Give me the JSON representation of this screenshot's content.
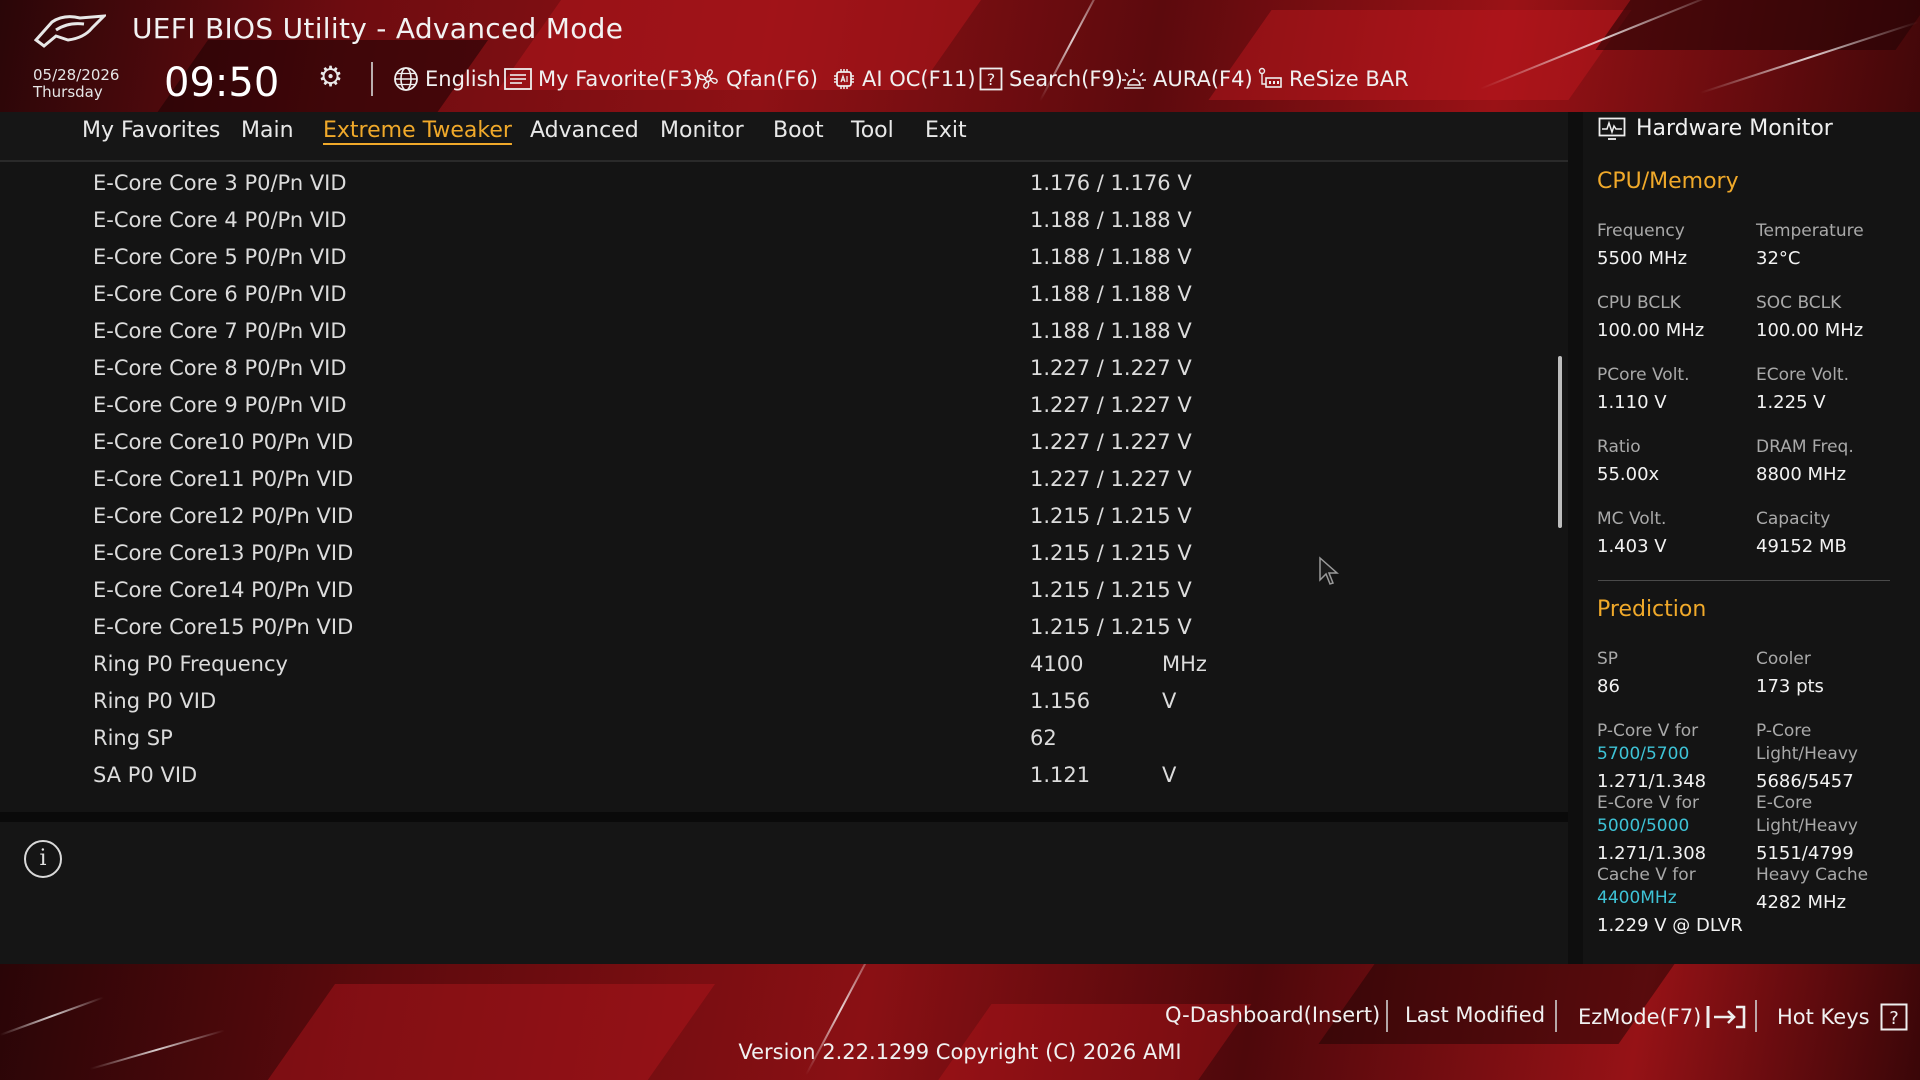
{
  "header": {
    "title": "UEFI BIOS Utility - Advanced Mode",
    "date": "05/28/2026",
    "day": "Thursday",
    "time": "09:50",
    "tools": [
      {
        "label": "English",
        "icon": "globe-icon"
      },
      {
        "label": "My Favorite(F3)",
        "icon": "favorite-list-icon"
      },
      {
        "label": "Qfan(F6)",
        "icon": "fan-icon"
      },
      {
        "label": "AI OC(F11)",
        "icon": "ai-chip-icon"
      },
      {
        "label": "Search(F9)",
        "icon": "search-help-icon"
      },
      {
        "label": "AURA(F4)",
        "icon": "aura-light-icon"
      },
      {
        "label": "ReSize BAR",
        "icon": "resize-bar-icon"
      }
    ]
  },
  "nav": {
    "items": [
      "My Favorites",
      "Main",
      "Extreme Tweaker",
      "Advanced",
      "Monitor",
      "Boot",
      "Tool",
      "Exit"
    ],
    "active": "Extreme Tweaker"
  },
  "settings": [
    {
      "label": "E-Core Core 3 P0/Pn VID",
      "value": "1.176 / 1.176 V",
      "unit": ""
    },
    {
      "label": "E-Core Core 4 P0/Pn VID",
      "value": "1.188 / 1.188 V",
      "unit": ""
    },
    {
      "label": "E-Core Core 5 P0/Pn VID",
      "value": "1.188 / 1.188 V",
      "unit": ""
    },
    {
      "label": "E-Core Core 6 P0/Pn VID",
      "value": "1.188 / 1.188 V",
      "unit": ""
    },
    {
      "label": "E-Core Core 7 P0/Pn VID",
      "value": "1.188 / 1.188 V",
      "unit": ""
    },
    {
      "label": "E-Core Core 8 P0/Pn VID",
      "value": "1.227 / 1.227 V",
      "unit": ""
    },
    {
      "label": "E-Core Core 9 P0/Pn VID",
      "value": "1.227 / 1.227 V",
      "unit": ""
    },
    {
      "label": "E-Core Core10 P0/Pn VID",
      "value": "1.227 / 1.227 V",
      "unit": ""
    },
    {
      "label": "E-Core Core11 P0/Pn VID",
      "value": "1.227 / 1.227 V",
      "unit": ""
    },
    {
      "label": "E-Core Core12 P0/Pn VID",
      "value": "1.215 / 1.215 V",
      "unit": ""
    },
    {
      "label": "E-Core Core13 P0/Pn VID",
      "value": "1.215 / 1.215 V",
      "unit": ""
    },
    {
      "label": "E-Core Core14 P0/Pn VID",
      "value": "1.215 / 1.215 V",
      "unit": ""
    },
    {
      "label": "E-Core Core15 P0/Pn VID",
      "value": "1.215 / 1.215 V",
      "unit": ""
    },
    {
      "label": "Ring P0 Frequency",
      "value": " 4100",
      "unit": "MHz"
    },
    {
      "label": "Ring P0 VID",
      "value": "1.156",
      "unit": "V"
    },
    {
      "label": "Ring SP",
      "value": " 62",
      "unit": ""
    },
    {
      "label": "SA P0 VID",
      "value": "1.121",
      "unit": "V"
    }
  ],
  "hardware_monitor": {
    "title": "Hardware Monitor",
    "cpu_memory": {
      "section": "CPU/Memory",
      "frequency_label": "Frequency",
      "frequency": "5500 MHz",
      "temperature_label": "Temperature",
      "temperature": "32°C",
      "cpu_bclk_label": "CPU BCLK",
      "cpu_bclk": "100.00 MHz",
      "soc_bclk_label": "SOC BCLK",
      "soc_bclk": "100.00 MHz",
      "pcore_volt_label": "PCore Volt.",
      "pcore_volt": "1.110 V",
      "ecore_volt_label": "ECore Volt.",
      "ecore_volt": "1.225 V",
      "ratio_label": "Ratio",
      "ratio": "55.00x",
      "dram_freq_label": "DRAM Freq.",
      "dram_freq": "8800 MHz",
      "mc_volt_label": "MC Volt.",
      "mc_volt": "1.403 V",
      "capacity_label": "Capacity",
      "capacity": "49152 MB"
    },
    "prediction": {
      "section": "Prediction",
      "sp_label": "SP",
      "sp": "86",
      "cooler_label": "Cooler",
      "cooler": "173 pts",
      "pcore_v_label": "P-Core V for",
      "pcore_v_freq": "5700/5700",
      "pcore_v": "1.271/1.348",
      "pcore_lh_label_1": "P-Core",
      "pcore_lh_label_2": "Light/Heavy",
      "pcore_lh": "5686/5457",
      "ecore_v_label": "E-Core V for",
      "ecore_v_freq": "5000/5000",
      "ecore_v": "1.271/1.308",
      "ecore_lh_label_1": "E-Core",
      "ecore_lh_label_2": "Light/Heavy",
      "ecore_lh": "5151/4799",
      "cache_v_label": "Cache V for",
      "cache_v_freq": "4400MHz",
      "cache_v": "1.229 V @ DLVR",
      "heavy_cache_label": "Heavy Cache",
      "heavy_cache": "4282 MHz"
    }
  },
  "footer": {
    "q_dashboard": "Q-Dashboard(Insert)",
    "last_modified": "Last Modified",
    "ezmode": "EzMode(F7)",
    "hot_keys": "Hot Keys",
    "version": "Version 2.22.1299 Copyright (C) 2026 AMI"
  },
  "colors": {
    "accent": "#f0a92a",
    "highlight_cyan": "#3ec3d6",
    "brand_red": "#8e1115"
  }
}
